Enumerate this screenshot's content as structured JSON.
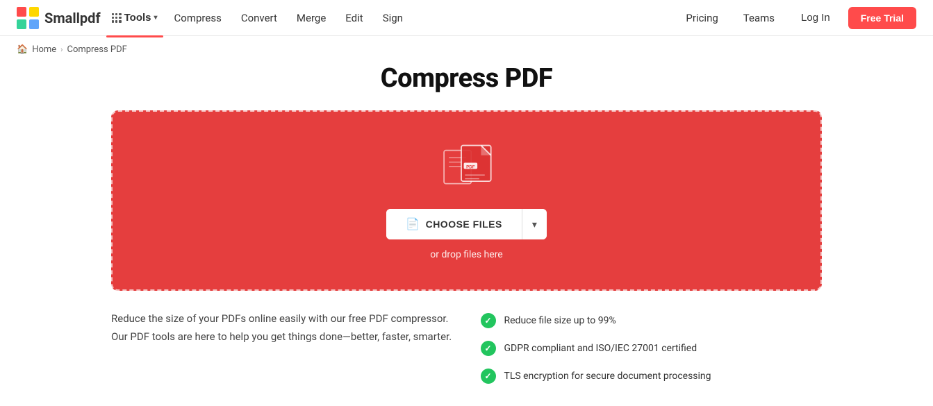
{
  "brand": {
    "name": "Smallpdf"
  },
  "nav": {
    "tools_label": "Tools",
    "compress_label": "Compress",
    "convert_label": "Convert",
    "merge_label": "Merge",
    "edit_label": "Edit",
    "sign_label": "Sign",
    "pricing_label": "Pricing",
    "teams_label": "Teams",
    "login_label": "Log In",
    "free_trial_label": "Free Trial"
  },
  "breadcrumb": {
    "home_label": "Home",
    "current_label": "Compress PDF"
  },
  "page": {
    "title": "Compress PDF",
    "drop_text": "or drop files here",
    "choose_files_label": "CHOOSE FILES"
  },
  "features": {
    "description": "Reduce the size of your PDFs online easily with our free PDF compressor. Our PDF tools are here to help you get things done—better, faster, smarter.",
    "items": [
      {
        "text": "Reduce file size up to 99%"
      },
      {
        "text": "GDPR compliant and ISO/IEC 27001 certified"
      },
      {
        "text": "TLS encryption for secure document processing"
      }
    ]
  }
}
